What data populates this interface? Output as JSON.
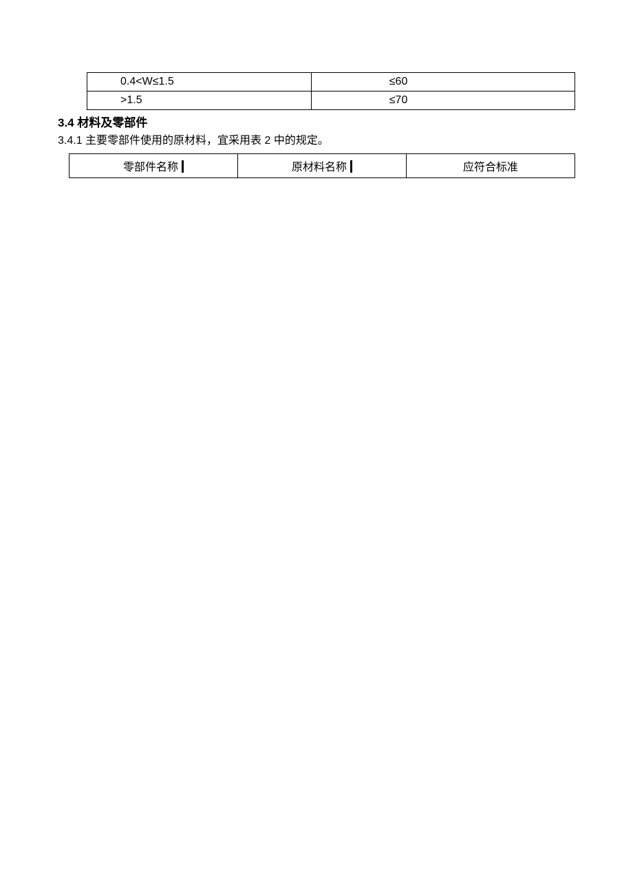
{
  "table1": {
    "rows": [
      {
        "range": "0.4<W≤1.5",
        "limit": "≤60"
      },
      {
        "range": ">1.5",
        "limit": "≤70"
      }
    ]
  },
  "section": {
    "number": "3.4",
    "title": "材料及零部件"
  },
  "para": {
    "text": "3.4.1 主要零部件使用的原材料，宜采用表 2 中的规定。"
  },
  "table2": {
    "headers": {
      "col1": "零部件名称",
      "col2": "原材料名称",
      "col3": "应符合标准"
    }
  }
}
